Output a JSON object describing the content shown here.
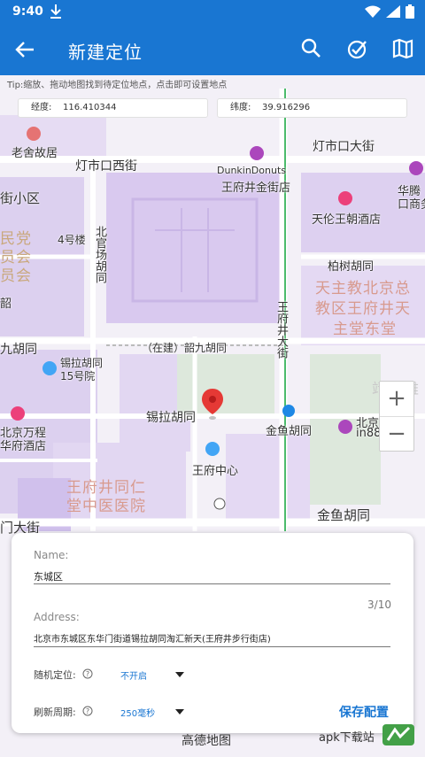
{
  "status": {
    "time": "9:40"
  },
  "appbar": {
    "title": "新建定位"
  },
  "map": {
    "tip": "Tip:缩放、拖动地图找到待定位地点，点击即可设置地点",
    "longitude_label": "经度:",
    "longitude_value": "116.410344",
    "latitude_label": "纬度:",
    "latitude_value": "39.916296",
    "labels": {
      "laoshe": "老舍故居",
      "dengshikou_xi": "灯市口西街",
      "dengshikou_da": "灯市口大街",
      "dunkin": "DunkinDonuts",
      "wangfujing_jinjie": "王府井金街店",
      "jiexiaoqu": "街小区",
      "tianlun": "天伦王朝酒店",
      "huateng1": "华腾",
      "huateng2": "口商务",
      "minjue": "民党",
      "yuanhui1": "员会",
      "yuanhui2": "员会",
      "shao": "韶",
      "building4": "4号楼",
      "beiguan": "北官场胡同",
      "baishu": "柏树胡同",
      "catholic1": "天主教北京总",
      "catholic2": "教区王府井天",
      "catholic3": "主堂东堂",
      "wangfujing_da": "王府井大街",
      "jiuhutong": "九胡同",
      "shaojiu": "（在建）韶九胡同",
      "xila15": "锡拉胡同15号院",
      "jingqin": "靖国雅",
      "xila": "锡拉胡同",
      "wanfang1": "北京万程",
      "wanfang2": "华府酒店",
      "jinyu": "金鱼胡同",
      "beijing_in88_1": "北京",
      "beijing_in88_2": "in88",
      "center": "王府中心",
      "tongren1": "王府井同仁",
      "tongren2": "堂中医医院",
      "mendajie": "门大街",
      "jinyu2": "金鱼胡同"
    },
    "zoom_in": "+",
    "zoom_out": "−"
  },
  "form": {
    "name_label": "Name:",
    "name_value": "东城区",
    "counter": "3/10",
    "address_label": "Address:",
    "address_value": "北京市东城区东华门街道锡拉胡同淘汇新天(王府井步行街店)",
    "random_label": "随机定位:",
    "random_value": "不开启",
    "refresh_label": "刷新周期:",
    "refresh_value": "250毫秒",
    "save_label": "保存配置"
  },
  "footer": {
    "logo_text": "高德地图",
    "right_text": "apk下载站"
  },
  "colors": {
    "primary": "#1976d2",
    "map_purple": "#d9c9ef",
    "road_yellow": "#ffffff",
    "pin_red": "#e53935"
  }
}
